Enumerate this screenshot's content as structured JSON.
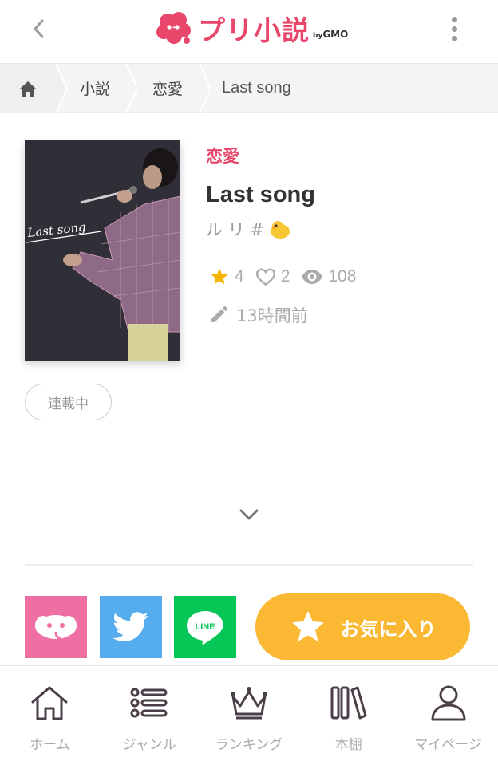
{
  "header": {
    "logo_text": "プリ小説",
    "logo_by": "by",
    "logo_company": "GMO"
  },
  "breadcrumb": {
    "items": [
      {
        "label": "小説"
      },
      {
        "label": "恋愛"
      },
      {
        "label": "Last song"
      }
    ]
  },
  "book": {
    "cover_text": "Last song",
    "genre": "恋愛",
    "title": "Last song",
    "author": "ル リ #",
    "stars": "4",
    "likes": "2",
    "views": "108",
    "updated": "13時間前",
    "status_badge": "連載中"
  },
  "actions": {
    "favorite_label": "お気に入り",
    "line_label": "LINE"
  },
  "bottom_nav": {
    "items": [
      {
        "label": "ホーム"
      },
      {
        "label": "ジャンル"
      },
      {
        "label": "ランキング"
      },
      {
        "label": "本棚"
      },
      {
        "label": "マイページ"
      }
    ]
  },
  "colors": {
    "brand": "#e8466a",
    "favorite": "#fbb832",
    "twitter": "#55acee",
    "line": "#06c755",
    "app_share": "#f06fa3",
    "star": "#f5b400"
  },
  "icons": {
    "back": "chevron-left-icon",
    "menu": "more-vertical-icon",
    "home": "home-icon",
    "star": "star-icon",
    "heart": "heart-icon",
    "eye": "eye-icon",
    "pencil": "pencil-icon",
    "expand": "chevron-down-icon"
  }
}
